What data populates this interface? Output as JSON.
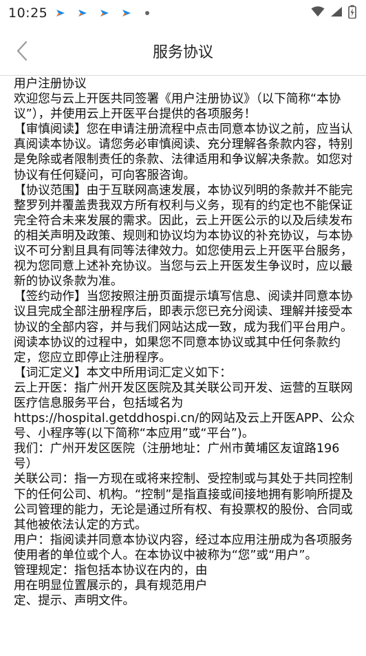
{
  "status_bar": {
    "time": "10:25",
    "notification_icons": [
      "send-notification-icon",
      "send-notification-icon",
      "send-notification-icon",
      "send-notification-icon"
    ],
    "accent": "#1e88e5",
    "accent2": "#ff7a1a"
  },
  "header": {
    "title": "服务协议"
  },
  "agreement": {
    "paragraphs": [
      "用户注册协议",
      "欢迎您与云上开医共同签署《用户注册协议》（以下简称“本协议”），并使用云上开医平台提供的各项服务！",
      "【审慎阅读】您在申请注册流程中点击同意本协议之前，应当认真阅读本协议。请您务必审慎阅读、充分理解各条款内容，特别是免除或者限制责任的条款、法律适用和争议解决条款。如您对协议有任何疑问，可向客服咨询。",
      "【协议范围】由于互联网高速发展，本协议列明的条款并不能完整罗列并覆盖贵我双方所有权利与义务，现有的约定也不能保证完全符合未来发展的需求。因此，云上开医公示的以及后续发布的相关声明及政策、规则和协议均为本协议的补充协议，与本协议不可分割且具有同等法律效力。如您使用云上开医平台服务，视为您同意上述补充协议。当您与云上开医发生争议时，应以最新的协议条款为准。",
      "【签约动作】当您按照注册页面提示填写信息、阅读并同意本协议且完成全部注册程序后，即表示您已充分阅读、理解并接受本协议的全部内容，并与我们网站达成一致，成为我们平台用户。阅读本协议的过程中，如果您不同意本协议或其中任何条款约定，您应立即停止注册程序。",
      "【词汇定义】本文中所用词汇定义如下：",
      "云上开医：指广州开发区医院及其关联公司开发、运营的互联网医疗信息服务平台，包括域名为https://hospital.getddhospi.cn/的网站及云上开医APP、公众号、小程序等(以下简称“本应用”或“平台”)。",
      "我们：广州开发区医院（注册地址：广州市黄埔区友谊路196号）",
      "关联公司：指一方现在或将来控制、受控制或与其处于共同控制下的任何公司、机构。“控制”是指直接或间接地拥有影响所提及公司管理的能力，无论是通过所有权、有投票权的股份、合同或其他被依法认定的方式。",
      "用户：指阅读并同意本协议内容，经过本应用注册成为各项服务使用者的单位或个人。在本协议中被称为“您”或“用户”。",
      "管理规定：指包括本协议在内的，由",
      "用在明显位置展示的，具有规范用户",
      "定、提示、声明文件。"
    ]
  }
}
